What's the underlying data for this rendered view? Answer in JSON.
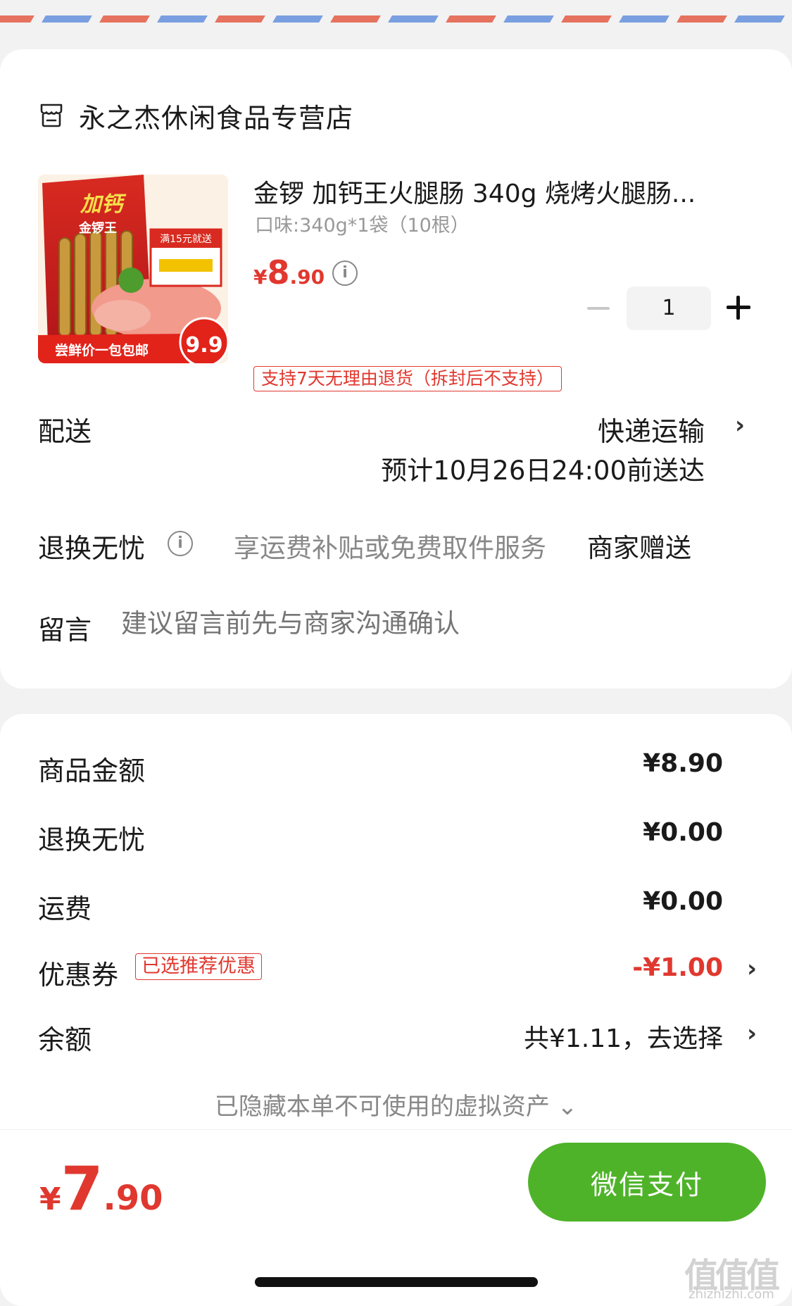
{
  "shop": {
    "name": "永之杰休闲食品专营店"
  },
  "product": {
    "title": "金锣 加钙王火腿肠 340g 烧烤火腿肠...",
    "spec": "口味:340g*1袋（10根）",
    "price_yen": "¥",
    "price_int": "8",
    "price_dec": ".90",
    "quantity": "1",
    "return_policy": "支持7天无理由退货（拆封后不支持）",
    "image_text": {
      "brand": "加钙",
      "sub": "金锣王",
      "promo": "满15元就送",
      "ribbon": "尝鲜价一包包邮",
      "badge_price": "9.9"
    }
  },
  "delivery": {
    "label": "配送",
    "method": "快递运输",
    "eta": "预计10月26日24:00前送达"
  },
  "worry_free": {
    "label": "退换无忧",
    "desc": "享运费补贴或免费取件服务",
    "gift": "商家赠送"
  },
  "message": {
    "label": "留言",
    "placeholder": "建议留言前先与商家沟通确认"
  },
  "summary": {
    "goods_label": "商品金额",
    "goods_value": "¥8.90",
    "worry_label": "退换无忧",
    "worry_value": "¥0.00",
    "shipping_label": "运费",
    "shipping_value": "¥0.00",
    "coupon_label": "优惠券",
    "coupon_badge": "已选推荐优惠",
    "coupon_value": "-¥1.00",
    "balance_label": "余额",
    "balance_value": "共¥1.11，去选择",
    "hidden_assets": "已隐藏本单不可使用的虚拟资产 ⌄"
  },
  "footer": {
    "total_yen": "¥",
    "total_int": "7",
    "total_dec": ".90",
    "pay_label": "微信支付"
  },
  "watermark": {
    "main": "值值值",
    "sub": "zhizhizhi.com"
  },
  "colors": {
    "accent_red": "#e0382f",
    "pay_green": "#4fb32a",
    "stripe_red": "#e5735f",
    "stripe_blue": "#7a9fe0"
  }
}
